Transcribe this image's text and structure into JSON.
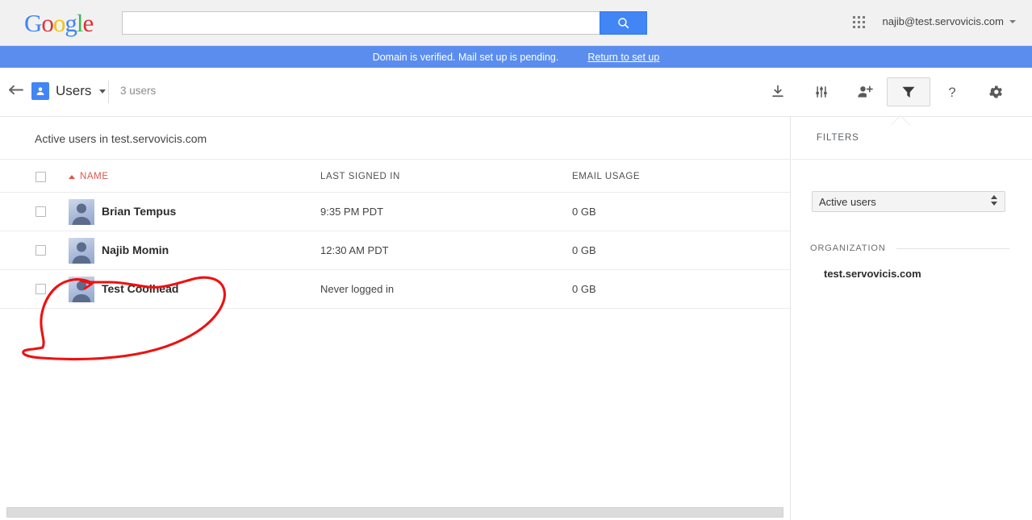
{
  "header": {
    "logo_letters": [
      {
        "ch": "G",
        "color": "#4285f4"
      },
      {
        "ch": "o",
        "color": "#db3236"
      },
      {
        "ch": "o",
        "color": "#f4c20d"
      },
      {
        "ch": "g",
        "color": "#4285f4"
      },
      {
        "ch": "l",
        "color": "#3cba54"
      },
      {
        "ch": "e",
        "color": "#db3236"
      }
    ],
    "search_value": "",
    "search_placeholder": "",
    "search_button_icon": "search-icon",
    "apps_icon": "apps-grid-icon",
    "account_email": "najib@test.servovicis.com",
    "account_caret_icon": "chevron-down-icon"
  },
  "banner": {
    "message": "Domain is verified. Mail set up is pending.",
    "link_label": "Return to set up",
    "background_color": "#5b8def"
  },
  "subbar": {
    "back_icon": "back-arrow-icon",
    "section_icon": "user-icon",
    "section_label": "Users",
    "section_caret_icon": "chevron-down-icon",
    "user_count": "3 users",
    "tools": [
      {
        "name": "download-button",
        "icon": "download-icon",
        "label": "Download"
      },
      {
        "name": "columns-button",
        "icon": "sliders-icon",
        "label": "Manage columns"
      },
      {
        "name": "add-user-button",
        "icon": "add-person-icon",
        "label": "Add new user"
      },
      {
        "name": "filter-button",
        "icon": "funnel-icon",
        "label": "Filters",
        "active": true
      },
      {
        "name": "help-button",
        "icon": "question-mark-icon",
        "label": "Help"
      },
      {
        "name": "settings-button",
        "icon": "gear-icon",
        "label": "Settings"
      }
    ]
  },
  "table": {
    "title": "Active users in test.servovicis.com",
    "columns": [
      {
        "key": "name",
        "label": "NAME",
        "sorted": true,
        "sort_direction": "asc",
        "color": "#d9584c"
      },
      {
        "key": "last_signed_in",
        "label": "LAST SIGNED IN"
      },
      {
        "key": "email_usage",
        "label": "EMAIL USAGE"
      }
    ],
    "rows": [
      {
        "name": "Brian Tempus",
        "last_signed_in": "9:35 PM PDT",
        "email_usage": "0 GB",
        "avatar": "default-avatar",
        "checked": false
      },
      {
        "name": "Najib Momin",
        "last_signed_in": "12:30 AM PDT",
        "email_usage": "0 GB",
        "avatar": "default-avatar",
        "checked": false
      },
      {
        "name": "Test Coolhead",
        "last_signed_in": "Never logged in",
        "email_usage": "0 GB",
        "avatar": "default-avatar",
        "checked": false
      }
    ]
  },
  "filters": {
    "heading": "FILTERS",
    "select_value": "Active users",
    "organization_heading": "ORGANIZATION",
    "organization_value": "test.servovicis.com"
  },
  "annotation": {
    "type": "hand-drawn-circle",
    "color": "#ee1111",
    "target": "Test Coolhead"
  }
}
